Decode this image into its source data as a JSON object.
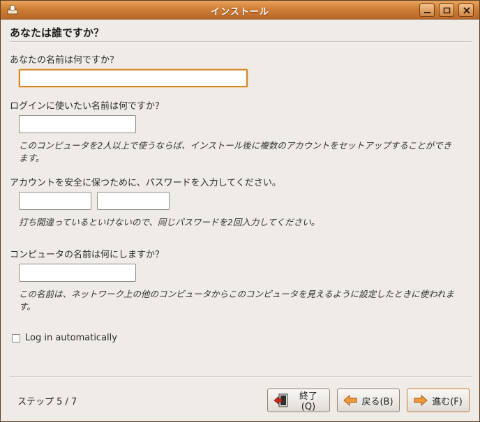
{
  "window": {
    "title": "インストール"
  },
  "page": {
    "heading": "あなたは誰ですか？"
  },
  "form": {
    "name_label": "あなたの名前は何ですか？",
    "name_value": "",
    "login_label": "ログインに使いたい名前は何ですか？",
    "login_value": "",
    "login_hint_line1": "このコンピュータを2人以上で使うならば、インストール後に複数のアカウントをセットアップすることができ",
    "login_hint_line2": "ます。",
    "password_label": "アカウントを安全に保つために、パスワードを入力してください。",
    "password_value": "",
    "password_confirm_value": "",
    "password_hint": "打ち間違っているといけないので、同じパスワードを2回入力してください。",
    "computer_label": "コンピュータの名前は何にしますか？",
    "computer_value": "",
    "computer_hint_line1": "この名前は、ネットワーク上の他のコンピュータからこのコンピュータを見えるように設定したときに使われま",
    "computer_hint_line2": "す。",
    "autologin_label": "Log in automatically",
    "autologin_checked": false
  },
  "footer": {
    "step_text": "ステップ 5 / 7",
    "quit_label": "終了(Q)",
    "back_label": "戻る(B)",
    "next_label": "進む(F)"
  }
}
